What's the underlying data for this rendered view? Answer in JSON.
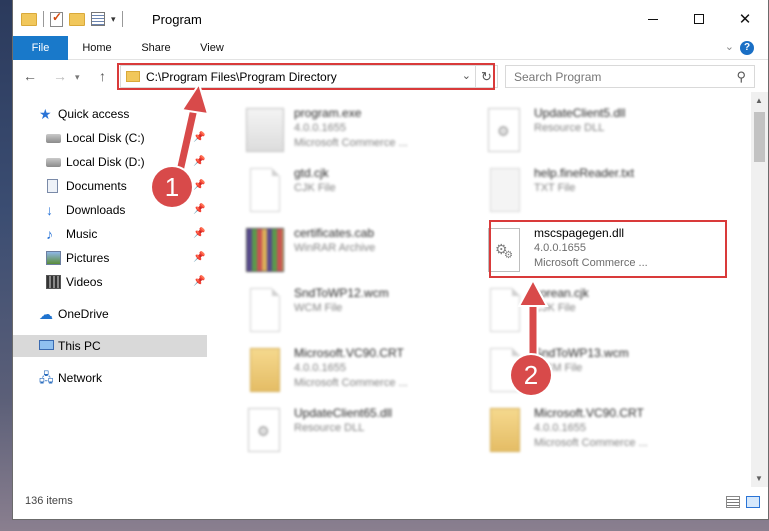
{
  "window": {
    "title": "Program",
    "controls": {
      "minimize": "minimize-icon",
      "maximize": "maximize-icon",
      "close": "close-icon"
    }
  },
  "ribbon": {
    "tabs": [
      {
        "label": "File"
      },
      {
        "label": "Home"
      },
      {
        "label": "Share"
      },
      {
        "label": "View"
      }
    ],
    "help_label": "?"
  },
  "address": {
    "path": "C:\\Program Files\\Program Directory",
    "search_placeholder": "Search Program"
  },
  "sidebar": {
    "items": [
      {
        "label": "Quick access",
        "icon": "star-icon"
      },
      {
        "label": "Local Disk (C:)",
        "icon": "disk-icon",
        "pinned": true
      },
      {
        "label": "Local Disk (D:)",
        "icon": "disk-icon",
        "pinned": true
      },
      {
        "label": "Documents",
        "icon": "documents-icon",
        "pinned": true
      },
      {
        "label": "Downloads",
        "icon": "download-icon",
        "pinned": true
      },
      {
        "label": "Music",
        "icon": "music-icon",
        "pinned": true
      },
      {
        "label": "Pictures",
        "icon": "pictures-icon",
        "pinned": true
      },
      {
        "label": "Videos",
        "icon": "videos-icon",
        "pinned": true
      },
      {
        "label": "OneDrive",
        "icon": "cloud-icon"
      },
      {
        "label": "This PC",
        "icon": "computer-icon",
        "selected": true
      },
      {
        "label": "Network",
        "icon": "network-icon"
      }
    ]
  },
  "files": [
    {
      "name": "program.exe",
      "line2": "4.0.0.1655",
      "line3": "Microsoft Commerce ...",
      "type": "exe"
    },
    {
      "name": "UpdateClient5.dll",
      "line2": "Resource DLL",
      "line3": "",
      "type": "dll"
    },
    {
      "name": "gtd.cjk",
      "line2": "CJK File",
      "line3": "",
      "type": "page"
    },
    {
      "name": "help.fineReader.txt",
      "line2": "TXT File",
      "line3": "",
      "type": "txt"
    },
    {
      "name": "certificates.cab",
      "line2": "WinRAR Archive",
      "line3": "",
      "type": "cab"
    },
    {
      "name": "mscspagegen.dll",
      "line2": "4.0.0.1655",
      "line3": "Microsoft Commerce ...",
      "type": "dll",
      "highlighted": true
    },
    {
      "name": "SndToWP12.wcm",
      "line2": "WCM File",
      "line3": "",
      "type": "page"
    },
    {
      "name": "korean.cjk",
      "line2": "CJK File",
      "line3": "",
      "type": "page"
    },
    {
      "name": "Microsoft.VC90.CRT",
      "line2": "4.0.0.1655",
      "line3": "Microsoft Commerce ...",
      "type": "folder"
    },
    {
      "name": "SndToWP13.wcm",
      "line2": "WCM File",
      "line3": "",
      "type": "page"
    },
    {
      "name": "UpdateClient65.dll",
      "line2": "Resource DLL",
      "line3": "",
      "type": "dll"
    },
    {
      "name": "Microsoft.VC90.CRT",
      "line2": "4.0.0.1655",
      "line3": "Microsoft Commerce ...",
      "type": "folder"
    }
  ],
  "status": {
    "item_count": "136 items"
  },
  "annotations": {
    "step1": "1",
    "step2": "2",
    "accent_color": "#d93a3a"
  },
  "colors": {
    "file_tab": "#1979ca",
    "selection": "#d9d9d9"
  }
}
